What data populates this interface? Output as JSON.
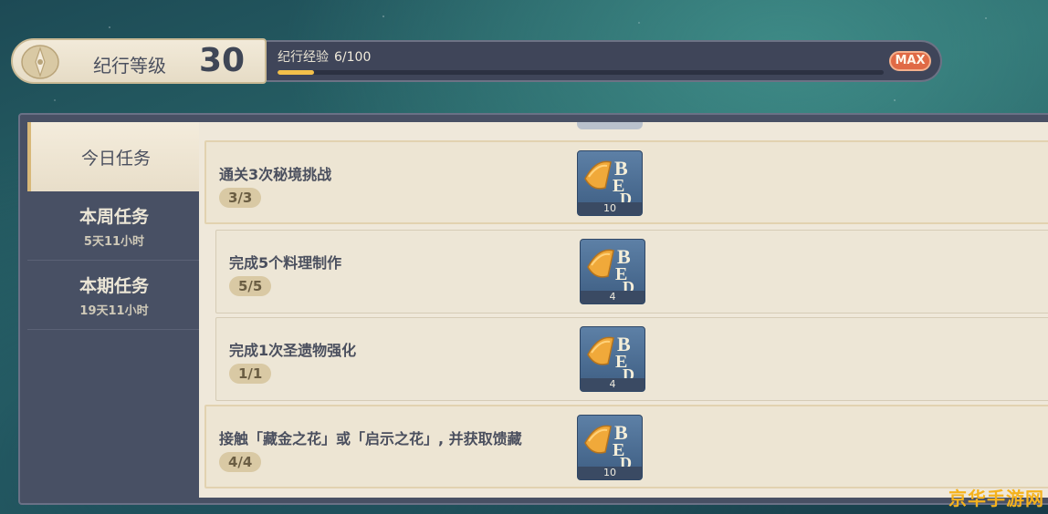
{
  "level": {
    "label": "纪行等级",
    "value": "30"
  },
  "exp": {
    "label": "纪行经验",
    "value": "6/100",
    "progress": 0.06,
    "max_badge": "MAX"
  },
  "sidebar": {
    "tabs": [
      {
        "title": "今日任务",
        "sub": ""
      },
      {
        "title": "本周任务",
        "sub": "5天11小时"
      },
      {
        "title": "本期任务",
        "sub": "19天11小时"
      }
    ]
  },
  "tasks": [
    {
      "title": "通关3次秘境挑战",
      "progress": "3/3",
      "reward_count": "10"
    },
    {
      "title": "完成5个料理制作",
      "progress": "5/5",
      "reward_count": "4"
    },
    {
      "title": "完成1次圣遗物强化",
      "progress": "1/1",
      "reward_count": "4"
    },
    {
      "title": "接触「藏金之花」或「启示之花」, 并获取馈藏",
      "progress": "4/4",
      "reward_count": "10"
    }
  ],
  "watermark": "京华手游网",
  "colors": {
    "accent": "#f3c04a",
    "max": "#e06a45",
    "panel": "#485064"
  }
}
